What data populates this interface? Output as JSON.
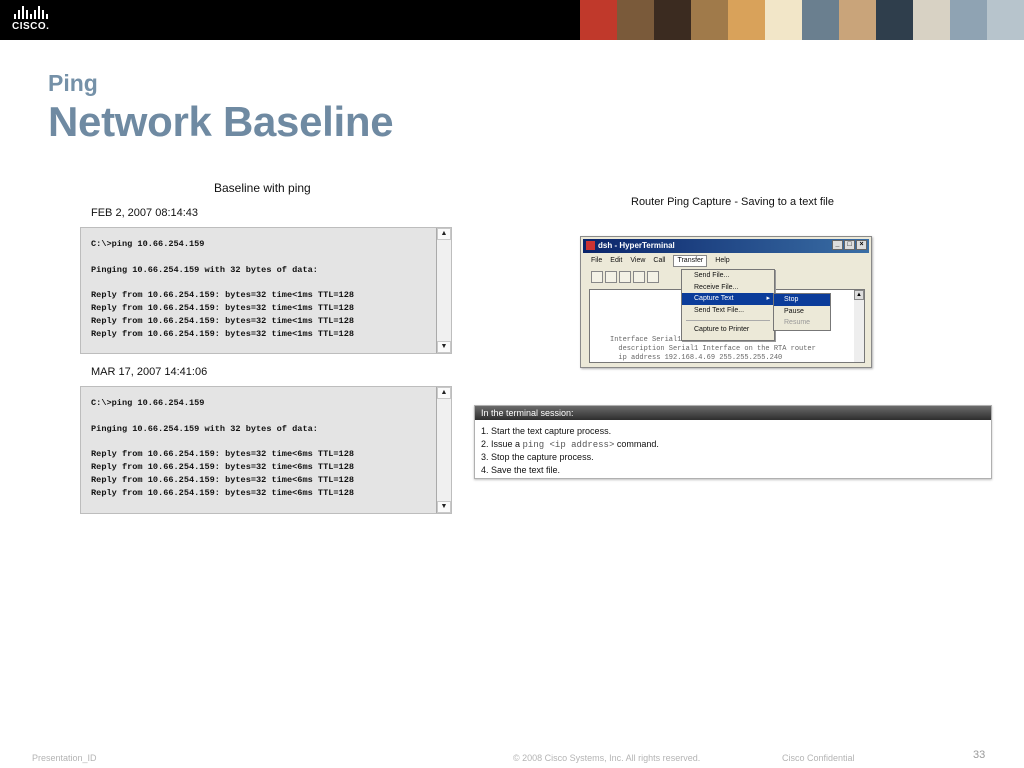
{
  "header": {
    "logo_text": "CISCO.",
    "photo_colors": [
      "#c0392b",
      "#7a5a3a",
      "#3b2b20",
      "#a07a4a",
      "#d9a25a",
      "#f2e6c8",
      "#6a7f8f",
      "#c9a47a",
      "#2f3e4c",
      "#d8d2c4",
      "#8fa3b3",
      "#b7c4cc"
    ]
  },
  "slide": {
    "subtitle": "Ping",
    "title": "Network Baseline"
  },
  "left": {
    "caption": "Baseline with ping",
    "capture1": {
      "date": "FEB 2, 2007  08:14:43",
      "lines": [
        "C:\\>ping 10.66.254.159",
        "",
        "Pinging 10.66.254.159 with 32 bytes of data:",
        "",
        "Reply from 10.66.254.159: bytes=32 time<1ms TTL=128",
        "Reply from 10.66.254.159: bytes=32 time<1ms TTL=128",
        "Reply from 10.66.254.159: bytes=32 time<1ms TTL=128",
        "Reply from 10.66.254.159: bytes=32 time<1ms TTL=128"
      ]
    },
    "capture2": {
      "date": "MAR 17, 2007  14:41:06",
      "lines": [
        "C:\\>ping 10.66.254.159",
        "",
        "Pinging 10.66.254.159 with 32 bytes of data:",
        "",
        "Reply from 10.66.254.159: bytes=32 time<6ms TTL=128",
        "Reply from 10.66.254.159: bytes=32 time<6ms TTL=128",
        "Reply from 10.66.254.159: bytes=32 time<6ms TTL=128",
        "Reply from 10.66.254.159: bytes=32 time<6ms TTL=128"
      ]
    }
  },
  "right": {
    "caption": "Router Ping Capture - Saving to a text file",
    "hyperterminal": {
      "title": "dsh - HyperTerminal",
      "menus": [
        "File",
        "Edit",
        "View",
        "Call",
        "Transfer",
        "Help"
      ],
      "transfer_menu": [
        "Send File...",
        "Receive File...",
        "Capture Text",
        "Send Text File...",
        "Capture to Printer"
      ],
      "capture_submenu": [
        "Stop",
        "Pause",
        "Resume"
      ],
      "body_lines": [
        "Interface Serial1",
        "  description Serial1 Interface on the RTA router",
        "  ip address 192.168.4.69 255.255.255.240"
      ]
    },
    "instructions": {
      "header": "In the terminal session:",
      "step1": "1. Start the text capture process.",
      "step2_pre": "2. Issue a ",
      "step2_cmd": "ping <ip address>",
      "step2_post": " command.",
      "step3": "3. Stop the capture process.",
      "step4": "4. Save the text file."
    }
  },
  "footer": {
    "left": "Presentation_ID",
    "copyright": "© 2008 Cisco Systems, Inc. All rights reserved.",
    "confidential": "Cisco Confidential",
    "page": "33"
  }
}
